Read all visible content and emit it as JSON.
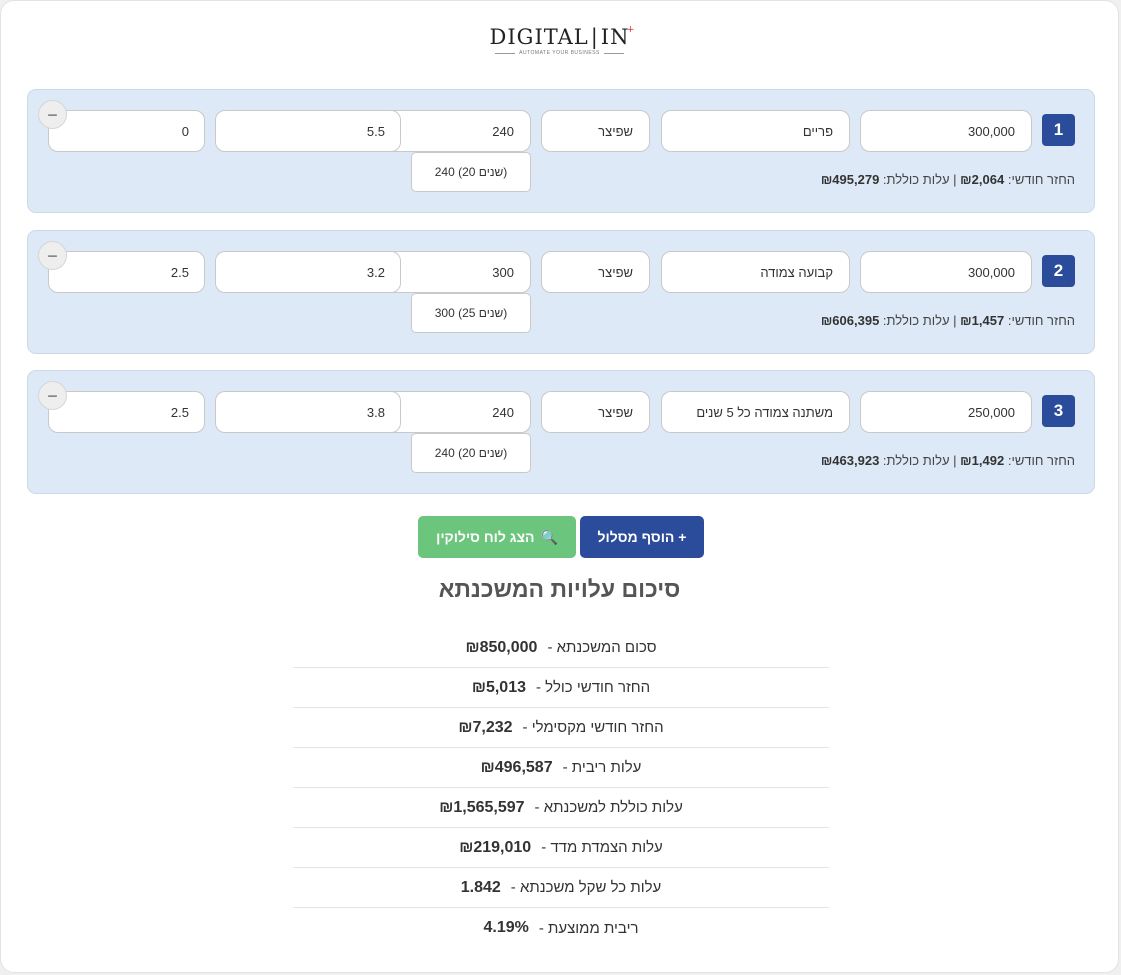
{
  "logo": {
    "main": "DIGITAL",
    "sep": "|",
    "in": "IN",
    "mark": "+",
    "tagline": "AUTOMATE YOUR BUSINESS"
  },
  "tracks": [
    {
      "number": "1",
      "amount": "300,000",
      "type": "פריים",
      "method": "שפיצר",
      "period": "240",
      "rate": "5.5",
      "index": "0",
      "period_option": "240 (20 שנים)",
      "monthly_label": "החזר חודשי:",
      "monthly_value": "₪2,064",
      "separator": "|",
      "total_label": "עלות כוללת:",
      "total_value": "₪495,279",
      "remove": "−"
    },
    {
      "number": "2",
      "amount": "300,000",
      "type": "קבועה צמודה",
      "method": "שפיצר",
      "period": "300",
      "rate": "3.2",
      "index": "2.5",
      "period_option": "300 (25 שנים)",
      "monthly_label": "החזר חודשי:",
      "monthly_value": "₪1,457",
      "separator": "|",
      "total_label": "עלות כוללת:",
      "total_value": "₪606,395",
      "remove": "−"
    },
    {
      "number": "3",
      "amount": "250,000",
      "type": "משתנה צמודה כל 5 שנים",
      "method": "שפיצר",
      "period": "240",
      "rate": "3.8",
      "index": "2.5",
      "period_option": "240 (20 שנים)",
      "monthly_label": "החזר חודשי:",
      "monthly_value": "₪1,492",
      "separator": "|",
      "total_label": "עלות כוללת:",
      "total_value": "₪463,923",
      "remove": "−"
    }
  ],
  "buttons": {
    "add": "+ הוסף מסלול",
    "show_schedule": "הצג לוח סילוקין",
    "show_icon": "magnifier-icon"
  },
  "summary": {
    "title": "סיכום עלויות המשכנתא",
    "rows": [
      {
        "label": "סכום המשכנתא -",
        "value": "₪850,000"
      },
      {
        "label": "החזר חודשי כולל -",
        "value": "₪5,013"
      },
      {
        "label": "החזר חודשי מקסימלי -",
        "value": "₪7,232"
      },
      {
        "label": "עלות ריבית -",
        "value": "₪496,587"
      },
      {
        "label": "עלות כוללת למשכנתא -",
        "value": "₪1,565,597"
      },
      {
        "label": "עלות הצמדת מדד -",
        "value": "₪219,010"
      },
      {
        "label": "עלות כל שקל משכנתא -",
        "value": "1.842"
      },
      {
        "label": "ריבית ממוצעת -",
        "value": "4.19%"
      }
    ]
  },
  "colors": {
    "accent": "#2b4c9b",
    "green": "#6cc57d",
    "track_bg": "#dde9f7"
  }
}
